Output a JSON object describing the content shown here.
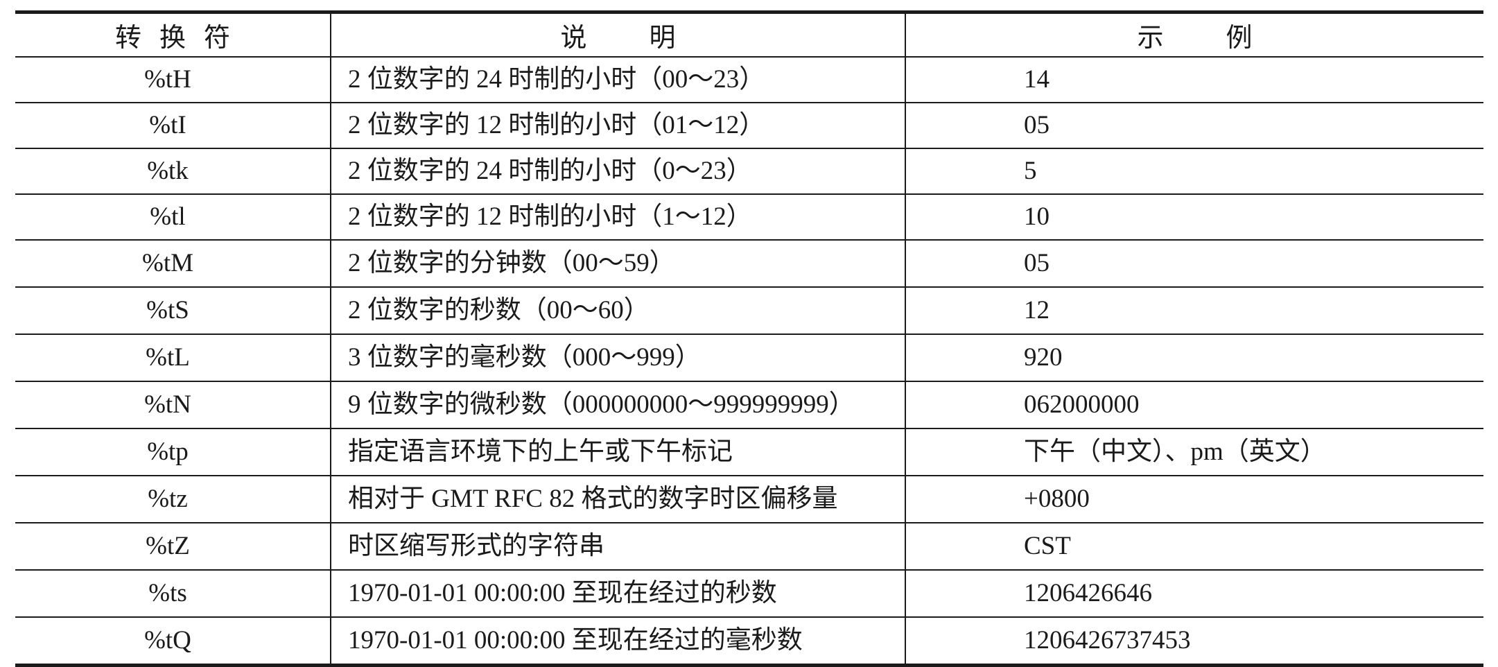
{
  "table": {
    "headers": {
      "conversion": "转换符",
      "description": "说明",
      "example": "示例"
    },
    "rows": [
      {
        "code": "%tH",
        "description": "2 位数字的 24 时制的小时（00～23）",
        "example": "14"
      },
      {
        "code": "%tI",
        "description": "2 位数字的 12 时制的小时（01～12）",
        "example": "05"
      },
      {
        "code": "%tk",
        "description": "2 位数字的 24 时制的小时（0～23）",
        "example": "5"
      },
      {
        "code": "%tl",
        "description": "2 位数字的 12 时制的小时（1～12）",
        "example": "10"
      },
      {
        "code": "%tM",
        "description": "2 位数字的分钟数（00～59）",
        "example": "05"
      },
      {
        "code": "%tS",
        "description": "2 位数字的秒数（00～60）",
        "example": "12"
      },
      {
        "code": "%tL",
        "description": "3 位数字的毫秒数（000～999）",
        "example": "920"
      },
      {
        "code": "%tN",
        "description": "9 位数字的微秒数（000000000～999999999）",
        "example": "062000000"
      },
      {
        "code": "%tp",
        "description": "指定语言环境下的上午或下午标记",
        "example": "下午（中文）、pm（英文）"
      },
      {
        "code": "%tz",
        "description": "相对于 GMT RFC 82 格式的数字时区偏移量",
        "example": "+0800"
      },
      {
        "code": "%tZ",
        "description": "时区缩写形式的字符串",
        "example": "CST"
      },
      {
        "code": "%ts",
        "description": "1970-01-01 00:00:00 至现在经过的秒数",
        "example": "1206426646"
      },
      {
        "code": "%tQ",
        "description": "1970-01-01 00:00:00 至现在经过的毫秒数",
        "example": "1206426737453"
      }
    ]
  }
}
